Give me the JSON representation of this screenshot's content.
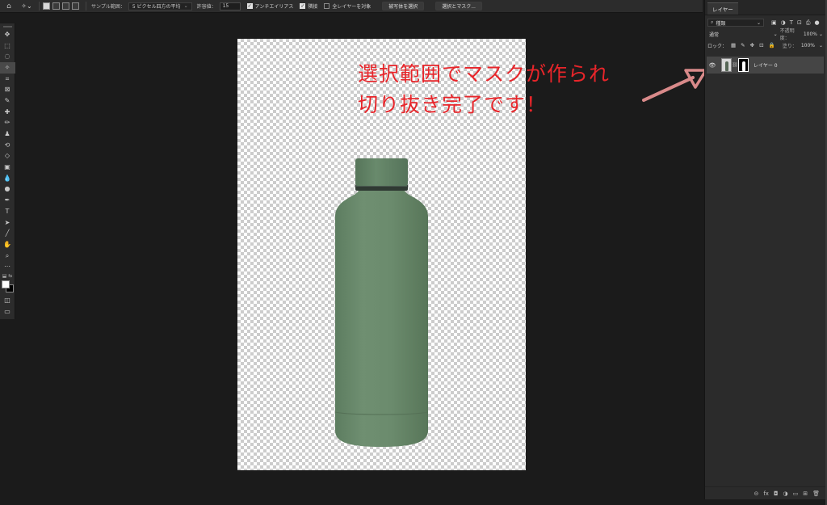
{
  "options_bar": {
    "home_icon": "home-icon",
    "tool_icon": "magic-wand-icon",
    "sample_label": "サンプル範囲：",
    "sample_value": "5 ピクセル四方の平均",
    "tolerance_label": "許容値：",
    "tolerance_value": "15",
    "antialias_label": "アンチエイリアス",
    "antialias_checked": true,
    "contiguous_label": "隣接",
    "contiguous_checked": true,
    "all_layers_label": "全レイヤーを対象",
    "all_layers_checked": false,
    "select_subject_label": "被写体を選択",
    "select_mask_label": "選択とマスク..."
  },
  "tools_panel": {
    "icons": [
      "move-icon",
      "marquee-icon",
      "lasso-icon",
      "magic-wand-icon",
      "crop-icon",
      "frame-icon",
      "eyedropper-icon",
      "healing-brush-icon",
      "brush-icon",
      "clone-stamp-icon",
      "history-brush-icon",
      "eraser-icon",
      "gradient-icon",
      "blur-icon",
      "dodge-icon",
      "pen-icon",
      "type-icon",
      "path-selection-icon",
      "line-icon",
      "hand-icon",
      "zoom-icon",
      "more-tools-icon"
    ],
    "glyphs": [
      "✥",
      "⬚",
      "◌",
      "✧",
      "⌗",
      "⊠",
      "✎",
      "✚",
      "✏",
      "♟",
      "⟲",
      "◇",
      "▣",
      "💧",
      "●",
      "✒",
      "T",
      "➤",
      "╱",
      "✋",
      "⌕",
      "⋯"
    ],
    "foreground_color": "#ffffff",
    "background_color": "#000000"
  },
  "annotation": {
    "line1": "選択範囲でマスクが作られ",
    "line2": "切り抜き完了です！",
    "color": "#e8252a"
  },
  "layers_panel": {
    "tab_label": "レイヤー",
    "kind_label": "種類",
    "blend_mode": "通常",
    "opacity_label": "不透明度：",
    "opacity_value": "100%",
    "lock_label": "ロック：",
    "fill_label": "塗り：",
    "fill_value": "100%",
    "layer_name": "レイヤー 0",
    "footer_icons": [
      "link-icon",
      "fx-icon",
      "mask-icon",
      "adjustment-icon",
      "folder-icon",
      "new-layer-icon",
      "trash-icon"
    ],
    "footer_glyphs": [
      "⊝",
      "fx",
      "◘",
      "◑",
      "▭",
      "⊞",
      "🗑"
    ]
  },
  "colors": {
    "bottle_body": "#6a8a6c",
    "canvas_checker": "#cccccc",
    "app_background": "#1b1b1b"
  }
}
